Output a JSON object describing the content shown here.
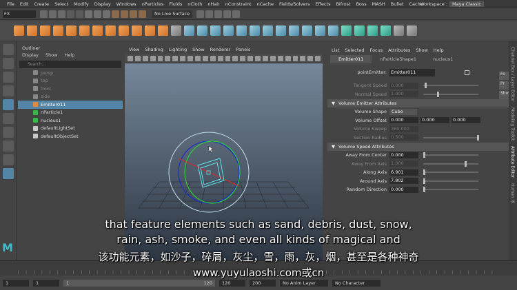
{
  "menubar": {
    "items": [
      "File",
      "Edit",
      "Create",
      "Select",
      "Modify",
      "Display",
      "Windows",
      "nParticles",
      "Fluids",
      "nCloth",
      "nHair",
      "nConstraint",
      "nCache",
      "Fields/Solvers",
      "Effects",
      "Bifrost",
      "Boss",
      "MASH",
      "Bullet",
      "Cache"
    ],
    "workspace_label": "Workspace :",
    "workspace_value": "Maya Classic"
  },
  "statusline": {
    "mode": "FX",
    "live_surface": "No Live Surface"
  },
  "outliner": {
    "title": "Outliner",
    "menu": [
      "Display",
      "Show",
      "Help"
    ],
    "search_placeholder": "Search...",
    "items": [
      {
        "label": "persp",
        "dim": true
      },
      {
        "label": "top",
        "dim": true
      },
      {
        "label": "front",
        "dim": true
      },
      {
        "label": "side",
        "dim": true
      },
      {
        "label": "Emitter011",
        "selected": true
      },
      {
        "label": "nParticle1"
      },
      {
        "label": "nucleus1"
      },
      {
        "label": "defaultLightSet"
      },
      {
        "label": "defaultObjectSet"
      }
    ]
  },
  "viewport": {
    "menu": [
      "View",
      "Shading",
      "Lighting",
      "Show",
      "Renderer",
      "Panels"
    ]
  },
  "attribute_editor": {
    "menu": [
      "List",
      "Selected",
      "Focus",
      "Attributes",
      "Show",
      "Help"
    ],
    "tabs": [
      "Emitter011",
      "nParticleShape1",
      "nucleus1"
    ],
    "emitter_label": "pointEmitter:",
    "emitter_name": "Emitter011",
    "side_buttons": [
      "Fo",
      "Pr",
      "Show"
    ],
    "rows_top": [
      {
        "label": "Tangent Speed",
        "value": "0.000",
        "dim": true
      },
      {
        "label": "Normal Speed",
        "value": "1.000",
        "dim": true
      }
    ],
    "section1": "Volume Emitter Attributes",
    "volume_shape_label": "Volume Shape",
    "volume_shape_value": "Cube",
    "volume_offset_label": "Volume Offset",
    "volume_offset_values": [
      "0.000",
      "0.000",
      "0.000"
    ],
    "volume_sweep_label": "Volume Sweep",
    "volume_sweep_value": "360.000",
    "section_radius_label": "Section Radius",
    "section_radius_value": "0.500",
    "section2": "Volume Speed Attributes",
    "speed_rows": [
      {
        "label": "Away From Center",
        "value": "0.000",
        "dim": false
      },
      {
        "label": "Away From Axis",
        "value": "1.000",
        "dim": true
      },
      {
        "label": "Along Axis",
        "value": "6.901",
        "dim": false
      },
      {
        "label": "Around Axis",
        "value": "7.802",
        "dim": false
      },
      {
        "label": "Random Direction",
        "value": "0.000",
        "dim": false
      }
    ]
  },
  "right_tabs": [
    "Channel Box / Layer Editor",
    "Modeling Toolkit",
    "Attribute Editor",
    "Human IK"
  ],
  "range": {
    "start": "1",
    "current": "1",
    "playback_start": "1",
    "playback_end_label": "120",
    "end": "120",
    "end2": "200",
    "anim_layer": "No Anim Layer",
    "character": "No Character"
  },
  "subtitles": {
    "line1": "that feature elements such as sand, debris, dust, snow,",
    "line2": "rain, ash, smoke, and even all kinds of magical and",
    "line3": "该功能元素，如沙子，碎屑，灰尘，雪，雨，灰，烟，甚至是各种神奇",
    "line4": "www.yuyulaoshi.com或cn"
  },
  "colors": {
    "selection": "#5285a6",
    "accent_orange": "#e38a3c",
    "accent_teal": "#3fb8c8"
  }
}
